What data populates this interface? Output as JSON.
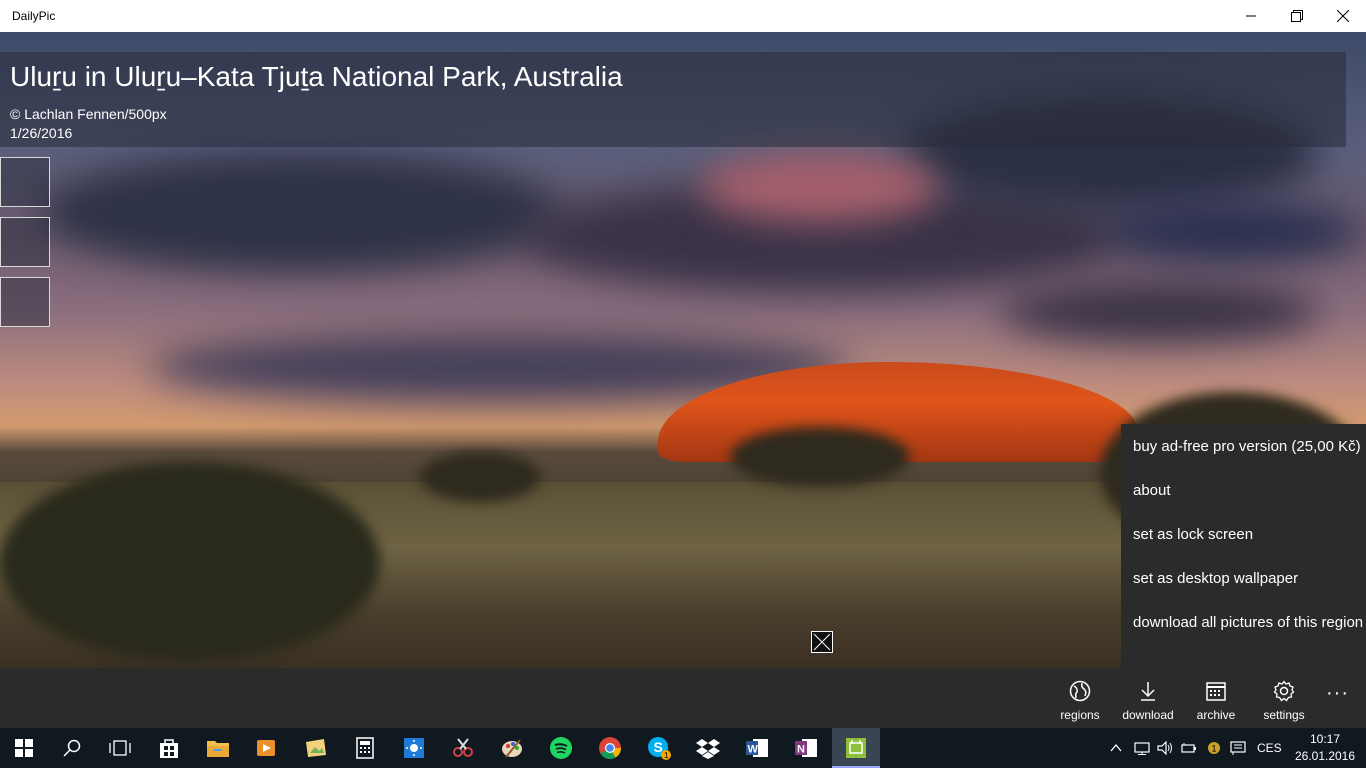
{
  "window": {
    "title": "DailyPic"
  },
  "photo": {
    "title": "Uluṟu in Uluṟu–Kata Tjuṯa National Park, Australia",
    "credit": "© Lachlan Fennen/500px",
    "date": "1/26/2016"
  },
  "menu": {
    "items": [
      "buy ad-free pro version (25,00 Kč)",
      "about",
      "set as lock screen",
      "set as desktop wallpaper",
      "download all pictures of this region"
    ]
  },
  "appbar": {
    "buttons": [
      {
        "label": "regions",
        "icon": "globe-icon"
      },
      {
        "label": "download",
        "icon": "download-icon"
      },
      {
        "label": "archive",
        "icon": "calendar-icon"
      },
      {
        "label": "settings",
        "icon": "gear-icon"
      }
    ],
    "more": "···"
  },
  "taskbar": {
    "language": "CES",
    "time": "10:17",
    "date": "26.01.2016"
  }
}
